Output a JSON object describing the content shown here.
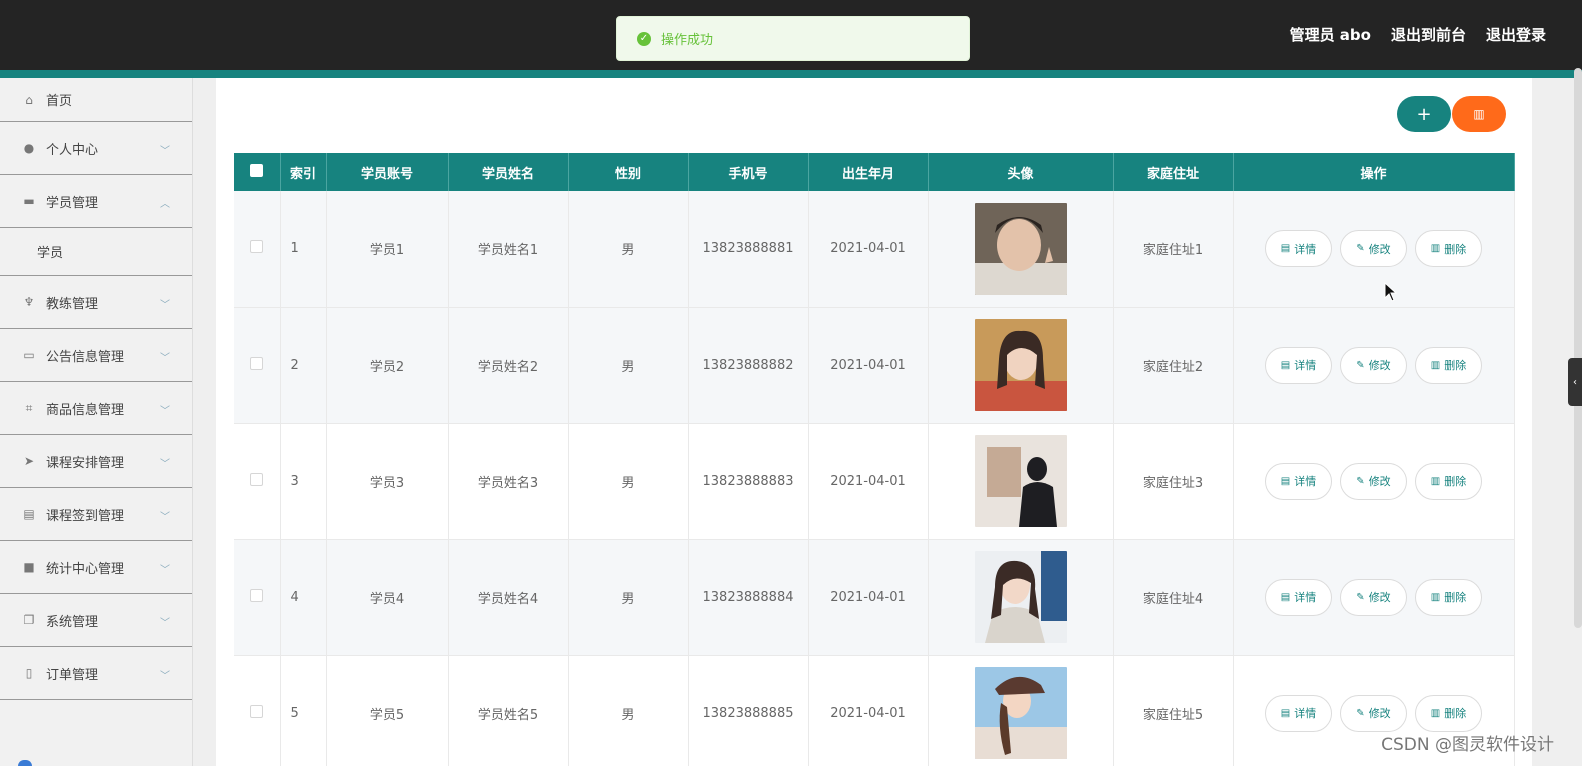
{
  "toast": {
    "message": "操作成功",
    "icon": "check-circle-icon",
    "color": "#67c23a"
  },
  "header": {
    "admin_label": "管理员 abo",
    "to_frontend": "退出到前台",
    "logout": "退出登录"
  },
  "sidebar": {
    "items": [
      {
        "label": "首页",
        "icon": "home-icon",
        "chevron": false
      },
      {
        "label": "个人中心",
        "icon": "user-icon",
        "chevron": "down"
      },
      {
        "label": "学员管理",
        "icon": "briefcase-icon",
        "chevron": "up"
      },
      {
        "label": "教练管理",
        "icon": "microphone-icon",
        "chevron": "down"
      },
      {
        "label": "公告信息管理",
        "icon": "message-icon",
        "chevron": "down"
      },
      {
        "label": "商品信息管理",
        "icon": "crop-icon",
        "chevron": "down"
      },
      {
        "label": "课程安排管理",
        "icon": "send-icon",
        "chevron": "down"
      },
      {
        "label": "课程签到管理",
        "icon": "clipboard-icon",
        "chevron": "down"
      },
      {
        "label": "统计中心管理",
        "icon": "video-icon",
        "chevron": "down"
      },
      {
        "label": "系统管理",
        "icon": "copy-icon",
        "chevron": "down"
      },
      {
        "label": "订单管理",
        "icon": "mobile-icon",
        "chevron": "down"
      }
    ],
    "subitem": "学员"
  },
  "toolbar": {
    "add": "+",
    "delete": "🗑"
  },
  "table": {
    "headers": [
      "索引",
      "学员账号",
      "学员姓名",
      "性别",
      "手机号",
      "出生年月",
      "头像",
      "家庭住址",
      "操作"
    ],
    "rows": [
      {
        "index": "1",
        "account": "学员1",
        "name": "学员姓名1",
        "gender": "男",
        "phone": "13823888881",
        "birth": "2021-04-01",
        "address": "家庭住址1"
      },
      {
        "index": "2",
        "account": "学员2",
        "name": "学员姓名2",
        "gender": "男",
        "phone": "13823888882",
        "birth": "2021-04-01",
        "address": "家庭住址2"
      },
      {
        "index": "3",
        "account": "学员3",
        "name": "学员姓名3",
        "gender": "男",
        "phone": "13823888883",
        "birth": "2021-04-01",
        "address": "家庭住址3"
      },
      {
        "index": "4",
        "account": "学员4",
        "name": "学员姓名4",
        "gender": "男",
        "phone": "13823888884",
        "birth": "2021-04-01",
        "address": "家庭住址4"
      },
      {
        "index": "5",
        "account": "学员5",
        "name": "学员姓名5",
        "gender": "男",
        "phone": "13823888885",
        "birth": "2021-04-01",
        "address": "家庭住址5"
      }
    ],
    "actions": {
      "detail": "详情",
      "edit": "修改",
      "delete": "删除"
    }
  },
  "watermark": "CSDN @图灵软件设计",
  "colors": {
    "primary": "#17837f",
    "danger": "#ff6a1a",
    "topbar": "#242424"
  }
}
